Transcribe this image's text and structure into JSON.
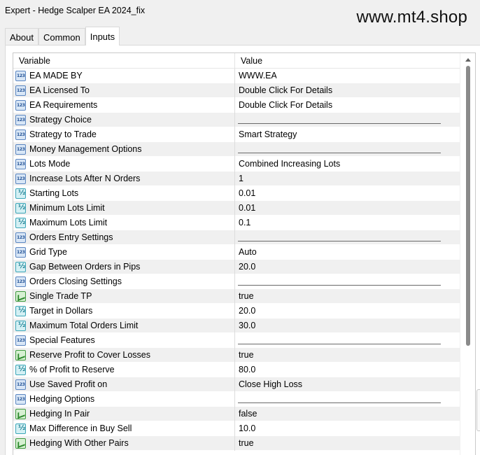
{
  "window": {
    "title": "Expert - Hedge Scalper EA 2024_fix"
  },
  "watermark": "www.mt4.shop",
  "tabs": [
    {
      "label": "About",
      "active": false
    },
    {
      "label": "Common",
      "active": false
    },
    {
      "label": "Inputs",
      "active": true
    }
  ],
  "table": {
    "headers": {
      "variable": "Variable",
      "value": "Value"
    },
    "rows": [
      {
        "type": "123",
        "name": "EA MADE BY",
        "value": "WWW.EA",
        "redacted": true
      },
      {
        "type": "123",
        "name": "EA Licensed To",
        "value": "Double Click For Details"
      },
      {
        "type": "123",
        "name": "EA Requirements",
        "value": "Double Click For Details"
      },
      {
        "type": "123",
        "name": "Strategy Choice",
        "value": "",
        "line": true
      },
      {
        "type": "123",
        "name": "Strategy to Trade",
        "value": "Smart Strategy"
      },
      {
        "type": "123",
        "name": "Money Management Options",
        "value": "",
        "line": true
      },
      {
        "type": "123",
        "name": "Lots Mode",
        "value": "Combined Increasing Lots"
      },
      {
        "type": "123",
        "name": "Increase Lots After N Orders",
        "value": "1"
      },
      {
        "type": "ve",
        "name": "Starting Lots",
        "value": "0.01"
      },
      {
        "type": "ve",
        "name": "Minimum Lots Limit",
        "value": "0.01"
      },
      {
        "type": "ve",
        "name": "Maximum Lots Limit",
        "value": "0.1"
      },
      {
        "type": "123",
        "name": "Orders Entry Settings",
        "value": "",
        "line": true
      },
      {
        "type": "123",
        "name": "Grid Type",
        "value": "Auto"
      },
      {
        "type": "ve",
        "name": "Gap Between Orders in Pips",
        "value": "20.0"
      },
      {
        "type": "123",
        "name": "Orders Closing Settings",
        "value": "",
        "line": true
      },
      {
        "type": "bool",
        "name": "Single Trade TP",
        "value": "true"
      },
      {
        "type": "ve",
        "name": "Target in Dollars",
        "value": "20.0"
      },
      {
        "type": "ve",
        "name": "Maximum Total Orders Limit",
        "value": "30.0"
      },
      {
        "type": "123",
        "name": "Special Features",
        "value": "",
        "line": true
      },
      {
        "type": "bool",
        "name": "Reserve Profit to Cover Losses",
        "value": "true"
      },
      {
        "type": "ve",
        "name": "% of Profit to Reserve",
        "value": "80.0"
      },
      {
        "type": "123",
        "name": "Use Saved Profit on",
        "value": "Close High Loss"
      },
      {
        "type": "123",
        "name": "Hedging Options",
        "value": "",
        "line": true
      },
      {
        "type": "bool",
        "name": "Hedging In Pair",
        "value": "false"
      },
      {
        "type": "ve",
        "name": "Max Difference in Buy Sell",
        "value": "10.0"
      },
      {
        "type": "bool",
        "name": "Hedging With Other Pairs",
        "value": "true"
      }
    ]
  }
}
